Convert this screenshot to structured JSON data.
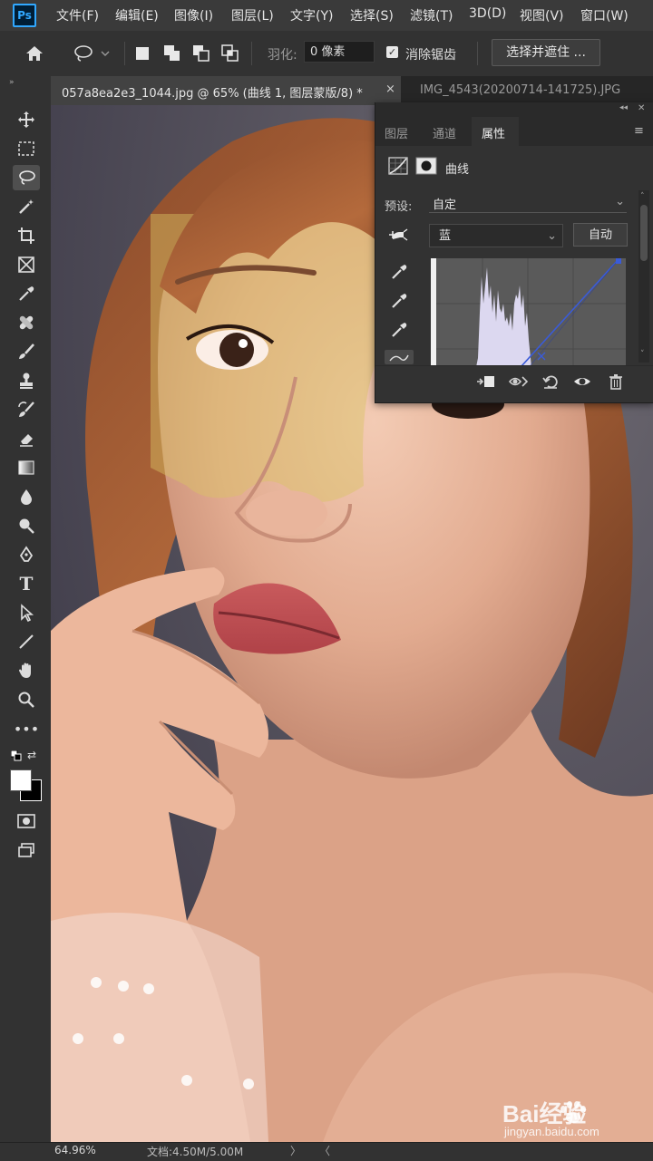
{
  "app": {
    "logo": "Ps"
  },
  "menu": [
    "文件(F)",
    "编辑(E)",
    "图像(I)",
    "图层(L)",
    "文字(Y)",
    "选择(S)",
    "滤镜(T)",
    "3D(D)",
    "视图(V)",
    "窗口(W)"
  ],
  "options": {
    "feather_label": "羽化:",
    "feather_value": "0 像素",
    "antialias_label": "消除锯齿",
    "antialias_checked": true,
    "select_mask_label": "选择并遮住 ..."
  },
  "tabs": {
    "active": "057a8ea2e3_1044.jpg @ 65% (曲线 1, 图层蒙版/8) *",
    "close": "×",
    "inactive": "IMG_4543(20200714-141725).JPG"
  },
  "panel": {
    "tabs": [
      "图层",
      "通道",
      "属性"
    ],
    "active_tab": "属性",
    "adjustment_label": "曲线",
    "preset_label": "预设:",
    "preset_value": "自定",
    "channel_value": "蓝",
    "auto_label": "自动"
  },
  "status": {
    "zoom": "64.96%",
    "doc": "文档:4.50M/5.00M"
  },
  "watermark": {
    "brand": "Bai经验",
    "url": "jingyan.baidu.com"
  },
  "colors": {
    "accent": "#31a8ff",
    "curve_line": "#3a5bd8",
    "histogram": "#dcd8f0"
  }
}
